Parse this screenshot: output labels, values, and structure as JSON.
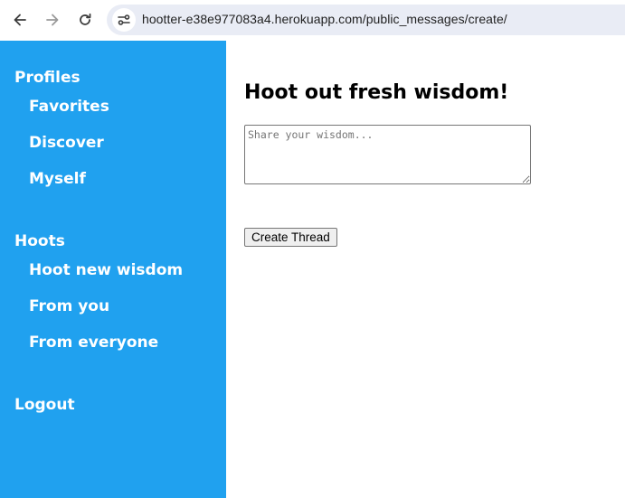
{
  "browser": {
    "url": "hootter-e38e977083a4.herokuapp.com/public_messages/create/",
    "icons": [
      "back-arrow-icon",
      "forward-arrow-icon",
      "reload-icon",
      "site-info-icon"
    ]
  },
  "sidebar": {
    "sections": [
      {
        "heading": "Profiles",
        "items": [
          "Favorites",
          "Discover",
          "Myself"
        ]
      },
      {
        "heading": "Hoots",
        "items": [
          "Hoot new wisdom",
          "From you",
          "From everyone"
        ]
      }
    ],
    "logout": "Logout",
    "color": "#20a1ef"
  },
  "main": {
    "title": "Hoot out fresh wisdom!",
    "input_placeholder": "Share your wisdom...",
    "input_value": "",
    "submit_label": "Create Thread"
  }
}
